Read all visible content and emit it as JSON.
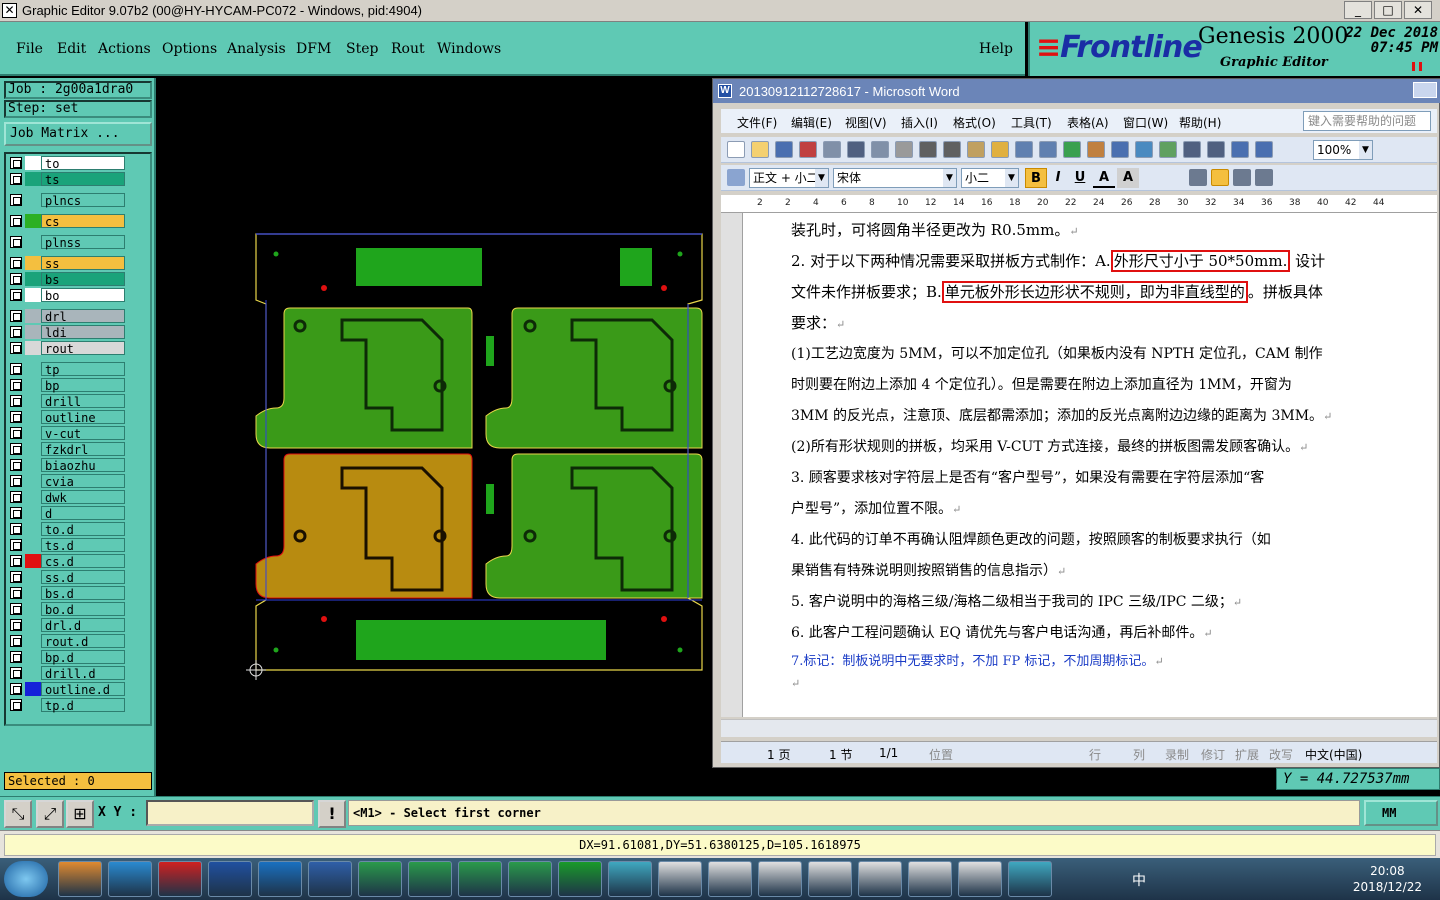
{
  "window": {
    "title": "Graphic Editor 9.07b2 (00@HY-HYCAM-PC072 - Windows, pid:4904)",
    "minimize": "_",
    "maximize": "□",
    "close": "✕"
  },
  "menu": {
    "items": [
      "File",
      "Edit",
      "Actions",
      "Options",
      "Analysis",
      "DFM",
      "Step",
      "Rout",
      "Windows"
    ],
    "help": "Help"
  },
  "brand": {
    "frontline": "Frontline",
    "genesis": "Genesis 2000",
    "subtitle": "Graphic Editor",
    "date": "22 Dec 2018",
    "time": "07:45 PM"
  },
  "job": {
    "job_line": "Job : 2g00a1dra0",
    "step_line": "Step: set",
    "matrix_button": "Job Matrix ...",
    "selected": "Selected : 0"
  },
  "layers": [
    {
      "name": "to",
      "color": "#ffffff",
      "swatch": "#ffffff"
    },
    {
      "name": "ts",
      "color": "#1aa37a",
      "swatch": "#1aa37a"
    },
    {
      "name": "plncs",
      "color": "#5fc9b4",
      "swatch": "#5fc9b4"
    },
    {
      "name": "cs",
      "color": "#f4bf3f",
      "swatch": "#2cb024"
    },
    {
      "name": "plnss",
      "color": "#5fc9b4",
      "swatch": "#5fc9b4"
    },
    {
      "name": "ss",
      "color": "#f4bf3f",
      "swatch": "#f4bf3f"
    },
    {
      "name": "bs",
      "color": "#1aa37a",
      "swatch": "#1aa37a"
    },
    {
      "name": "bo",
      "color": "#ffffff",
      "swatch": "#ffffff"
    },
    {
      "name": "drl",
      "color": "#a9b5bb",
      "swatch": "#a9b5bb"
    },
    {
      "name": "ldi",
      "color": "#a9b5bb",
      "swatch": "#a9b5bb"
    },
    {
      "name": "rout",
      "color": "#d8d8d8",
      "swatch": "#d8d8d8"
    },
    {
      "name": "tp",
      "color": "#5fc9b4",
      "swatch": "#5fc9b4"
    },
    {
      "name": "bp",
      "color": "#5fc9b4",
      "swatch": "#5fc9b4"
    },
    {
      "name": "drill",
      "color": "#5fc9b4",
      "swatch": "#5fc9b4"
    },
    {
      "name": "outline",
      "color": "#5fc9b4",
      "swatch": "#5fc9b4"
    },
    {
      "name": "v-cut",
      "color": "#5fc9b4",
      "swatch": "#5fc9b4"
    },
    {
      "name": "fzkdrl",
      "color": "#5fc9b4",
      "swatch": "#5fc9b4"
    },
    {
      "name": "biaozhu",
      "color": "#5fc9b4",
      "swatch": "#5fc9b4"
    },
    {
      "name": "cvia",
      "color": "#5fc9b4",
      "swatch": "#5fc9b4"
    },
    {
      "name": "dwk",
      "color": "#5fc9b4",
      "swatch": "#5fc9b4"
    },
    {
      "name": "d",
      "color": "#5fc9b4",
      "swatch": "#5fc9b4"
    },
    {
      "name": "to.d",
      "color": "#5fc9b4",
      "swatch": "#5fc9b4"
    },
    {
      "name": "ts.d",
      "color": "#5fc9b4",
      "swatch": "#5fc9b4"
    },
    {
      "name": "cs.d",
      "color": "#5fc9b4",
      "swatch": "#e01010"
    },
    {
      "name": "ss.d",
      "color": "#5fc9b4",
      "swatch": "#5fc9b4"
    },
    {
      "name": "bs.d",
      "color": "#5fc9b4",
      "swatch": "#5fc9b4"
    },
    {
      "name": "bo.d",
      "color": "#5fc9b4",
      "swatch": "#5fc9b4"
    },
    {
      "name": "drl.d",
      "color": "#5fc9b4",
      "swatch": "#5fc9b4"
    },
    {
      "name": "rout.d",
      "color": "#5fc9b4",
      "swatch": "#5fc9b4"
    },
    {
      "name": "bp.d",
      "color": "#5fc9b4",
      "swatch": "#5fc9b4"
    },
    {
      "name": "drill.d",
      "color": "#5fc9b4",
      "swatch": "#5fc9b4"
    },
    {
      "name": "outline.d",
      "color": "#5fc9b4",
      "swatch": "#1521d9"
    },
    {
      "name": "tp.d",
      "color": "#5fc9b4",
      "swatch": "#5fc9b4"
    }
  ],
  "word": {
    "title": "20130912112728617 - Microsoft Word",
    "menu": [
      "文件(F)",
      "编辑(E)",
      "视图(V)",
      "插入(I)",
      "格式(O)",
      "工具(T)",
      "表格(A)",
      "窗口(W)",
      "帮助(H)"
    ],
    "help_placeholder": "键入需要帮助的问题",
    "zoom": "100%",
    "style": "正文 + 小二",
    "font": "宋体",
    "size": "小二",
    "ruler_ticks": [
      "2",
      "2",
      "4",
      "6",
      "8",
      "10",
      "12",
      "14",
      "16",
      "18",
      "20",
      "22",
      "24",
      "26",
      "28",
      "30",
      "32",
      "34",
      "36",
      "38",
      "40",
      "42",
      "44"
    ],
    "lines": [
      "装孔时，可将圆角半径更改为 R0.5mm。",
      "2. 对于以下两种情况需要采取拼板方式制作：A.",
      "外形尺寸小于 50*50mm.",
      " 设计",
      "文件未作拼板要求；B.",
      "单元板外形长边形状不规则，即为非直线型的",
      "。拼板具体",
      "要求：",
      "(1)工艺边宽度为 5MM，可以不加定位孔（如果板内没有 NPTH 定位孔，CAM 制作",
      "时则要在附边上添加 4 个定位孔）。但是需要在附边上添加直径为 1MM，开窗为",
      "3MM 的反光点，注意顶、底层都需添加；添加的反光点离附边边缘的距离为 3MM。",
      "(2)所有形状规则的拼板，均采用 V-CUT 方式连接，最终的拼板图需发顾客确认。",
      "3. 顾客要求核对字符层上是否有“客户型号”，如果没有需要在字符层添加“客",
      "户型号”，添加位置不限。",
      "4. 此代码的订单不再确认阻焊颜色更改的问题，按照顾客的制板要求执行（如",
      "果销售有特殊说明则按照销售的信息指示）",
      "5. 客户说明中的海格三级/海格二级相当于我司的 IPC 三级/IPC 二级；",
      "6. 此客户工程问题确认 EQ 请优先与客户电话沟通，再后补邮件。",
      "7.标记：制板说明中无要求时，不加 FP 标记，不加周期标记。"
    ],
    "status": {
      "page": "1 页",
      "section": "1 节",
      "pages": "1/1",
      "position": "位置",
      "line": "行",
      "col": "列",
      "rec": "录制",
      "trk": "修订",
      "ext": "扩展",
      "ovr": "改写",
      "lang": "中文(中国)"
    }
  },
  "coords": {
    "y_readout": "Y = 44.727537mm",
    "xy_label": "X Y :",
    "message": "<M1> - Select first corner",
    "units": "MM",
    "measure": "DX=91.61081,DY=51.6380125,D=105.1618975"
  },
  "taskbar": {
    "time": "20:08",
    "date": "2018/12/22",
    "ime": "中"
  }
}
